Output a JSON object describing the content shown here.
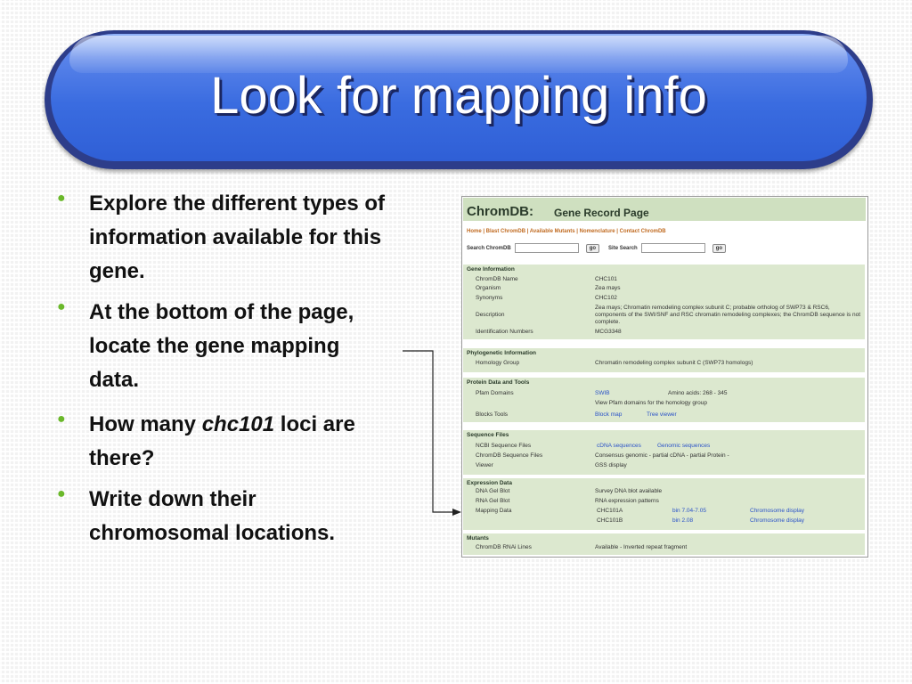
{
  "slide": {
    "title": "Look for mapping info",
    "bullets": [
      {
        "lines": [
          "Explore the different types of",
          "information available for this",
          "gene."
        ]
      },
      {
        "lines": [
          "At the bottom of the page,",
          "locate the gene mapping",
          "data."
        ]
      },
      {
        "pre": "How many ",
        "em": "chc101",
        "post": " loci are",
        "line2": "there?"
      },
      {
        "lines": [
          "Write down their",
          "chromosomal locations."
        ]
      }
    ]
  },
  "colors": {
    "title_bg": "#3a6ce0",
    "bullet": "#6ab82a",
    "panel_header": "#cfe0c0",
    "link": "#2a52c8"
  },
  "screenshot": {
    "brand": "ChromDB:",
    "subtitle": "Gene Record Page",
    "nav": "Home | Blast ChromDB | Available Mutants | Nomenclature | Contact ChromDB",
    "search_label": "Search ChromDB",
    "search_button": "go",
    "site_search_label": "Site Search",
    "site_search_button": "go",
    "gene_info": {
      "title": "Gene Information",
      "rows": [
        {
          "label": "ChromDB Name",
          "value": "CHC101"
        },
        {
          "label": "Organism",
          "value": "Zea mays"
        },
        {
          "label": "Synonyms",
          "value": "CHC102"
        },
        {
          "label": "Description",
          "value": "Zea mays; Chromatin remodeling complex subunit C; probable ortholog of SWP73 & RSC6, components of the SWI/SNF and RSC chromatin remodeling complexes; the ChromDB sequence is not complete."
        },
        {
          "label": "Identification Numbers",
          "value": "MCG3348"
        }
      ]
    },
    "phylo": {
      "title": "Phylogenetic Information",
      "label": "Homology Group",
      "value": "Chromatin remodeling complex subunit C (SWP73 homologs)"
    },
    "protein": {
      "title": "Protein Data and Tools",
      "pfam_label": "Pfam Domains",
      "pfam_link": "SWIB",
      "pfam_amino": "Amino acids: 268 - 345",
      "pfam_view": "View Pfam domains for the homology group",
      "blocks_label": "Blocks Tools",
      "block_map": "Block map",
      "tree_viewer": "Tree viewer"
    },
    "sequence": {
      "title": "Sequence Files",
      "ncbi_label": "NCBI Sequence Files",
      "cdna": "cDNA sequences",
      "genomic": "Genomic sequences",
      "chromdb_label": "ChromDB Sequence Files",
      "consensus": "Consensus genomic - partial cDNA - partial Protein -",
      "viewer_label": "Viewer",
      "gss": "GSS display"
    },
    "expression": {
      "title": "Expression Data",
      "dna_label": "DNA Gel Blot",
      "dna_value": "Survey DNA blot available",
      "rna_label": "RNA Gel Blot",
      "rna_value": "RNA expression patterns",
      "mapping_label": "Mapping Data",
      "mapping": [
        {
          "locus": "CHC101A",
          "bin": "bin 7.04-7.05",
          "display": "Chromosome display"
        },
        {
          "locus": "CHC101B",
          "bin": "bin 2.08",
          "display": "Chromosome display"
        }
      ]
    },
    "mutants": {
      "title": "Mutants",
      "label": "ChromDB RNAi Lines",
      "value": "Available - Inverted repeat fragment"
    }
  }
}
